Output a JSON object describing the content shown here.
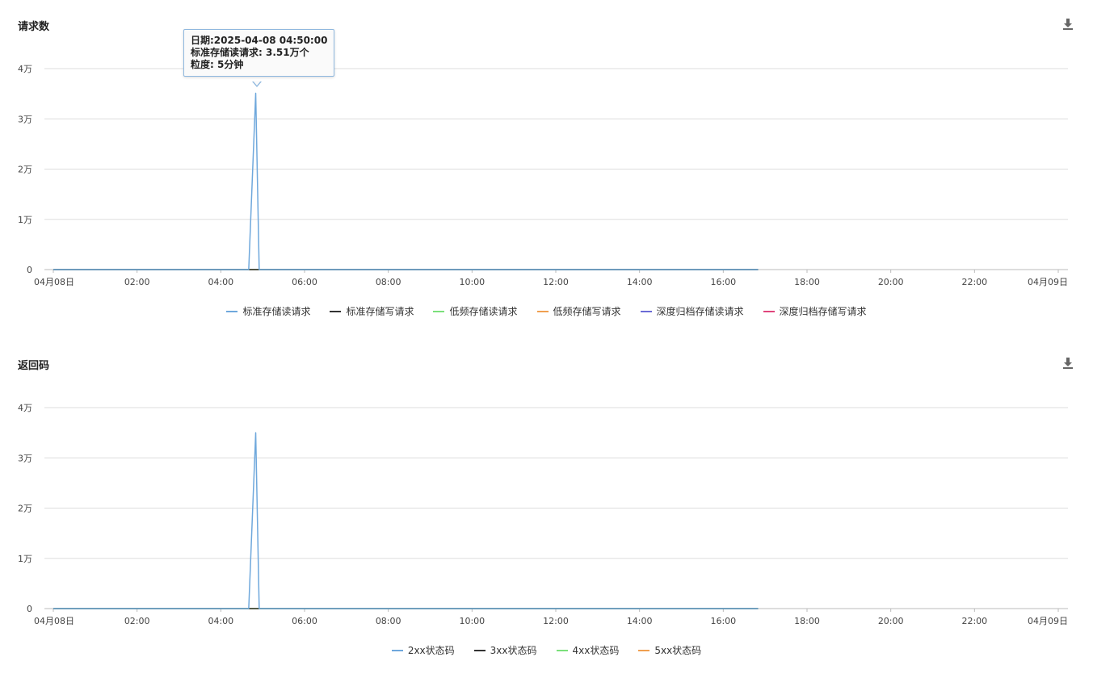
{
  "chart_data": [
    {
      "type": "line",
      "title": "请求数",
      "x_ticks": [
        "04月08日",
        "02:00",
        "04:00",
        "06:00",
        "08:00",
        "10:00",
        "12:00",
        "14:00",
        "16:00",
        "18:00",
        "20:00",
        "22:00",
        "04月09日"
      ],
      "y_ticks": [
        "0",
        "1万",
        "2万",
        "3万",
        "4万"
      ],
      "ylim": [
        0,
        40000
      ],
      "xlim_hours": [
        0,
        24
      ],
      "grid": true,
      "legend_position": "bottom",
      "series": [
        {
          "name": "标准存储读请求",
          "color": "#6fa8dc",
          "x": [
            "00:00",
            "04:40",
            "04:50",
            "04:55",
            "16:50"
          ],
          "values": [
            0,
            0,
            35100,
            0,
            0
          ]
        },
        {
          "name": "标准存储写请求",
          "color": "#333333",
          "x": [
            "00:00",
            "16:50"
          ],
          "values": [
            0,
            0
          ]
        },
        {
          "name": "低频存储读请求",
          "color": "#7be07b",
          "x": [
            "00:00",
            "16:50"
          ],
          "values": [
            0,
            0
          ]
        },
        {
          "name": "低频存储写请求",
          "color": "#f0a050",
          "x": [
            "00:00",
            "16:50"
          ],
          "values": [
            0,
            0
          ]
        },
        {
          "name": "深度归档存储读请求",
          "color": "#6b6bd6",
          "x": [
            "00:00",
            "16:50"
          ],
          "values": [
            0,
            0
          ]
        },
        {
          "name": "深度归档存储写请求",
          "color": "#e0457b",
          "x": [
            "00:00",
            "16:50"
          ],
          "values": [
            0,
            0
          ]
        }
      ],
      "tooltip": {
        "line1": "日期:2025-04-08 04:50:00",
        "line2": "标准存储读请求: 3.51万个",
        "line3": "粒度:   5分钟"
      }
    },
    {
      "type": "line",
      "title": "返回码",
      "x_ticks": [
        "04月08日",
        "02:00",
        "04:00",
        "06:00",
        "08:00",
        "10:00",
        "12:00",
        "14:00",
        "16:00",
        "18:00",
        "20:00",
        "22:00",
        "04月09日"
      ],
      "y_ticks": [
        "0",
        "1万",
        "2万",
        "3万",
        "4万"
      ],
      "ylim": [
        0,
        40000
      ],
      "xlim_hours": [
        0,
        24
      ],
      "grid": true,
      "legend_position": "bottom",
      "series": [
        {
          "name": "2xx状态码",
          "color": "#6fa8dc",
          "x": [
            "00:00",
            "04:40",
            "04:50",
            "04:55",
            "16:50"
          ],
          "values": [
            0,
            0,
            35000,
            0,
            0
          ]
        },
        {
          "name": "3xx状态码",
          "color": "#333333",
          "x": [
            "00:00",
            "16:50"
          ],
          "values": [
            0,
            0
          ]
        },
        {
          "name": "4xx状态码",
          "color": "#7be07b",
          "x": [
            "00:00",
            "16:50"
          ],
          "values": [
            0,
            0
          ]
        },
        {
          "name": "5xx状态码",
          "color": "#f0a050",
          "x": [
            "00:00",
            "16:50"
          ],
          "values": [
            0,
            0
          ]
        }
      ]
    }
  ],
  "icons": {
    "download": "download-icon"
  }
}
